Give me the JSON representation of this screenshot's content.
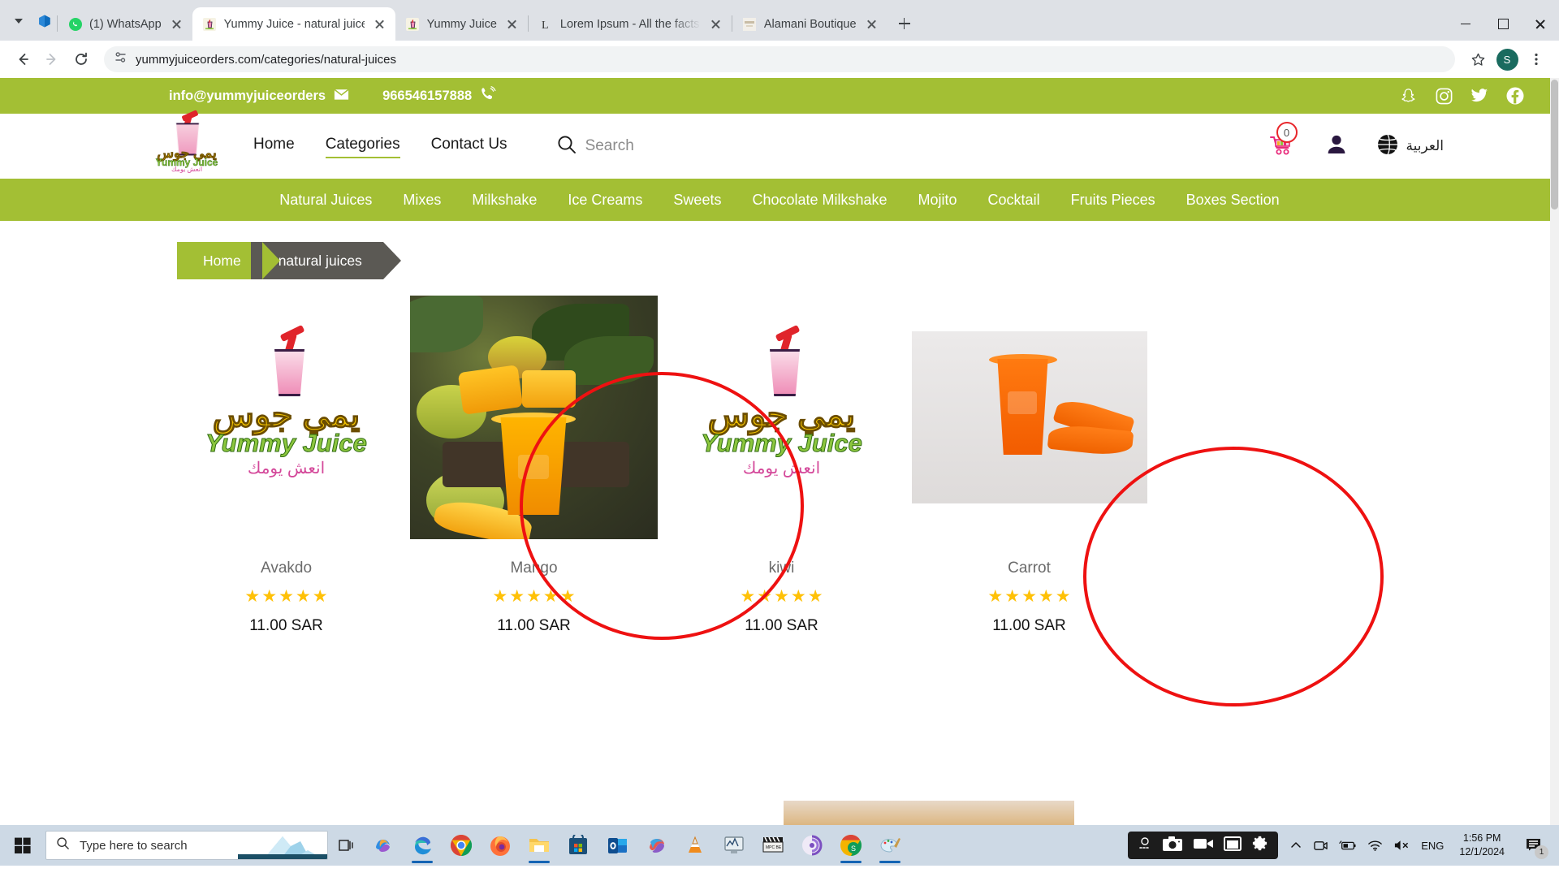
{
  "browser": {
    "tabs": [
      {
        "title": "(1) WhatsApp",
        "favicon": "whatsapp-icon",
        "active": false
      },
      {
        "title": "Yummy Juice - natural juices",
        "favicon": "yummyjuice-icon",
        "active": true
      },
      {
        "title": "Yummy Juice",
        "favicon": "yummyjuice-icon",
        "active": false
      },
      {
        "title": "Lorem Ipsum - All the facts - Lip",
        "favicon": "lipsum-icon",
        "active": false
      },
      {
        "title": "Alamani Boutique",
        "favicon": "alamani-icon",
        "active": false
      }
    ],
    "url": "yummyjuiceorders.com/categories/natural-juices",
    "profile_initial": "S",
    "window_controls": {
      "minimize": "minimize",
      "maximize": "maximize",
      "close": "close"
    }
  },
  "site": {
    "topbar": {
      "email": "info@yummyjuiceorders",
      "phone": "966546157888",
      "socials": [
        "snapchat-icon",
        "instagram-icon",
        "twitter-icon",
        "facebook-icon"
      ]
    },
    "logo": {
      "arabic": "يمي جوس",
      "english": "Yummy Juice",
      "tagline": "انعش يومك"
    },
    "nav": [
      {
        "label": "Home",
        "active": false
      },
      {
        "label": "Categories",
        "active": true
      },
      {
        "label": "Contact Us",
        "active": false
      }
    ],
    "search_placeholder": "Search",
    "cart_count": "0",
    "language_label": "العربية",
    "categories": [
      "Natural Juices",
      "Mixes",
      "Milkshake",
      "Ice Creams",
      "Sweets",
      "Chocolate Milkshake",
      "Mojito",
      "Cocktail",
      "Fruits Pieces",
      "Boxes Section"
    ],
    "breadcrumb": [
      {
        "label": "Home",
        "current": false
      },
      {
        "label": "natural juices",
        "current": true
      }
    ],
    "products": [
      {
        "name": "Avakdo",
        "price": "11.00 SAR",
        "stars": 5,
        "art": "logo",
        "annotated": false
      },
      {
        "name": "Mango",
        "price": "11.00 SAR",
        "stars": 5,
        "art": "mango",
        "annotated": true
      },
      {
        "name": "kiwi",
        "price": "11.00 SAR",
        "stars": 5,
        "art": "logo",
        "annotated": false
      },
      {
        "name": "Carrot",
        "price": "11.00 SAR",
        "stars": 5,
        "art": "carrot",
        "annotated": true
      }
    ],
    "colors": {
      "brand_green": "#a3bf34",
      "breadcrumb_gray": "#5b5954",
      "star_gold": "#ffc107",
      "annotation_red": "#ee1111"
    }
  },
  "taskbar": {
    "search_placeholder": "Type here to search",
    "apps": [
      "task-view-icon",
      "copilot-icon",
      "edge-icon",
      "chrome-icon",
      "firefox-icon",
      "file-explorer-icon",
      "microsoft-store-icon",
      "outlook-icon",
      "office-icon",
      "vlc-icon",
      "performance-monitor-icon",
      "mpc-be-icon",
      "bittorrent-icon",
      "chrome-secondary-icon",
      "paint-icon"
    ],
    "recorder": [
      "screenrec-more-icon",
      "camera-icon",
      "video-icon",
      "window-icon",
      "settings-gear-icon"
    ],
    "tray": [
      "show-hidden-icons-icon",
      "camera-tray-icon",
      "battery-icon",
      "wifi-icon",
      "volume-muted-icon"
    ],
    "language": "ENG",
    "time": "1:56 PM",
    "date": "12/1/2024",
    "notification_count": "1"
  }
}
